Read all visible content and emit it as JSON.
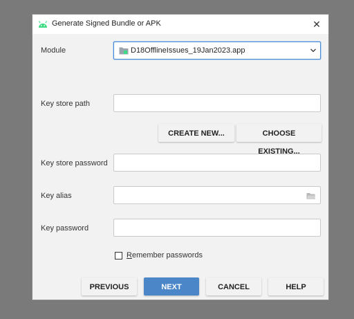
{
  "dialog": {
    "title": "Generate Signed Bundle or APK",
    "close_glyph": "✕",
    "icons": {
      "title": "android-icon",
      "module": "module-folder-icon",
      "dropdown": "chevron-down-icon",
      "browse": "folder-icon"
    }
  },
  "module": {
    "label": "Module",
    "value": "D18OfflineIssues_19Jan2023.app"
  },
  "keystore": {
    "path_label": "Key store path",
    "path_value": "",
    "create_new": "CREATE NEW...",
    "choose_existing": "CHOOSE EXISTING...",
    "password_label": "Key store password",
    "password_value": ""
  },
  "key": {
    "alias_label": "Key alias",
    "alias_value": "",
    "password_label": "Key password",
    "password_value": ""
  },
  "remember": {
    "mnemonic": "R",
    "rest": "emember passwords",
    "checked": false
  },
  "buttons": {
    "previous": "PREVIOUS",
    "next": "NEXT",
    "cancel": "CANCEL",
    "help": "HELP"
  },
  "colors": {
    "accent": "#4a86c8",
    "android_green": "#3ddc84"
  }
}
